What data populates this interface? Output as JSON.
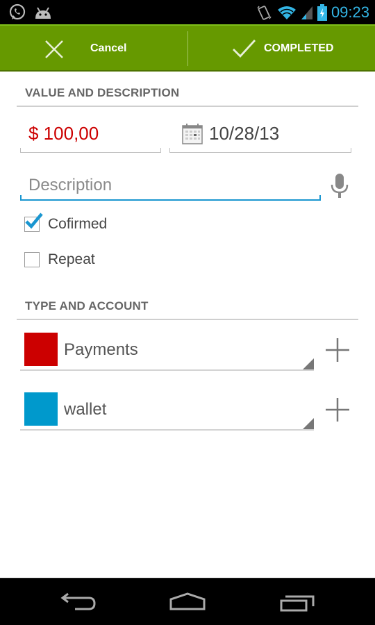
{
  "status_bar": {
    "left_icons": [
      "whatsapp-icon",
      "android-icon"
    ],
    "right_icons": [
      "vibrate-icon",
      "wifi-icon",
      "signal-icon",
      "battery-charging-icon"
    ],
    "time": "09:23",
    "accent_color": "#33b5e5"
  },
  "action_bar": {
    "background_color": "#669900",
    "cancel_label": "Cancel",
    "cancel_icon": "close-icon",
    "done_label": "COMPLETED",
    "done_icon": "check-icon"
  },
  "value_section": {
    "title": "VALUE AND DESCRIPTION",
    "amount": "$ 100,00",
    "amount_color": "#cc0000",
    "date_icon": "calendar-icon",
    "date": "10/28/13",
    "description_placeholder": "Description",
    "description_value": "",
    "mic_icon": "microphone-icon",
    "checkboxes": [
      {
        "label": "Cofirmed",
        "checked": true
      },
      {
        "label": "Repeat",
        "checked": false
      }
    ]
  },
  "type_section": {
    "title": "TYPE AND ACCOUNT",
    "spinners": [
      {
        "label": "Payments",
        "color": "#cc0000",
        "add_icon": "plus-icon"
      },
      {
        "label": "wallet",
        "color": "#0099cc",
        "add_icon": "plus-icon"
      }
    ]
  },
  "nav_bar": {
    "buttons": [
      "back-icon",
      "home-icon",
      "recent-apps-icon"
    ]
  }
}
